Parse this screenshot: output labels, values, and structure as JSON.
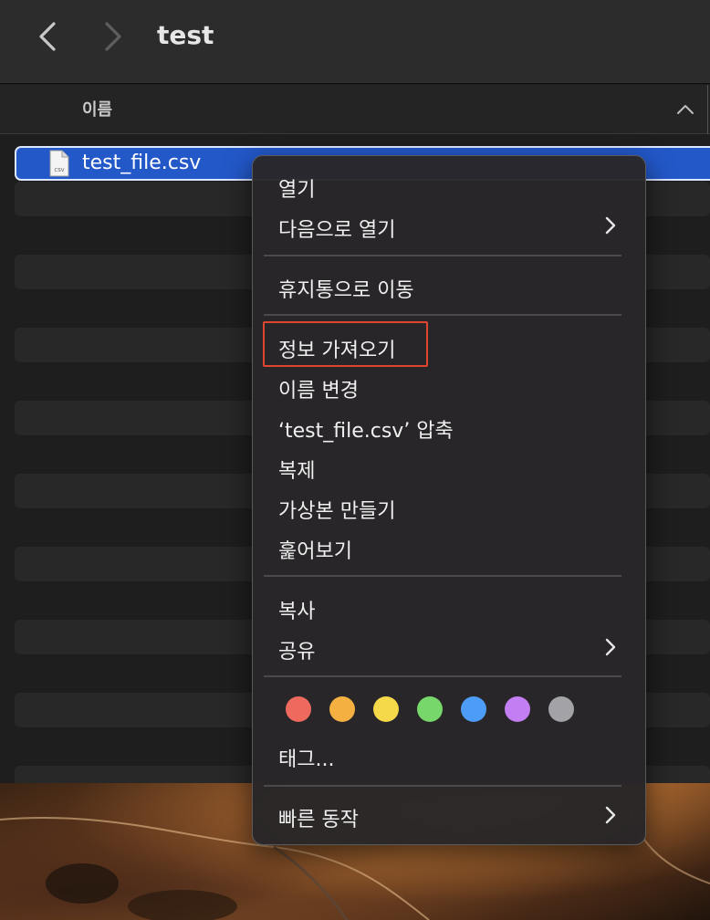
{
  "window": {
    "title": "test"
  },
  "column": {
    "name": "이름"
  },
  "file": {
    "name": "test_file.csv",
    "icon_label": "CSV"
  },
  "menu": {
    "open": "열기",
    "open_with": "다음으로 열기",
    "move_to_trash": "휴지통으로 이동",
    "get_info": "정보 가져오기",
    "rename": "이름 변경",
    "compress": "‘test_file.csv’ 압축",
    "duplicate": "복제",
    "make_alias": "가상본 만들기",
    "quick_look": "훑어보기",
    "copy": "복사",
    "share": "공유",
    "tags": "태그...",
    "quick_actions": "빠른 동작"
  },
  "tag_colors": [
    "#ee6a5f",
    "#f4b142",
    "#f5d94a",
    "#78d76a",
    "#4d9cf8",
    "#c27ef2",
    "#a3a3a7"
  ],
  "accent_colors": {
    "selection": "#2358c9",
    "highlight_box": "#e0452f"
  }
}
